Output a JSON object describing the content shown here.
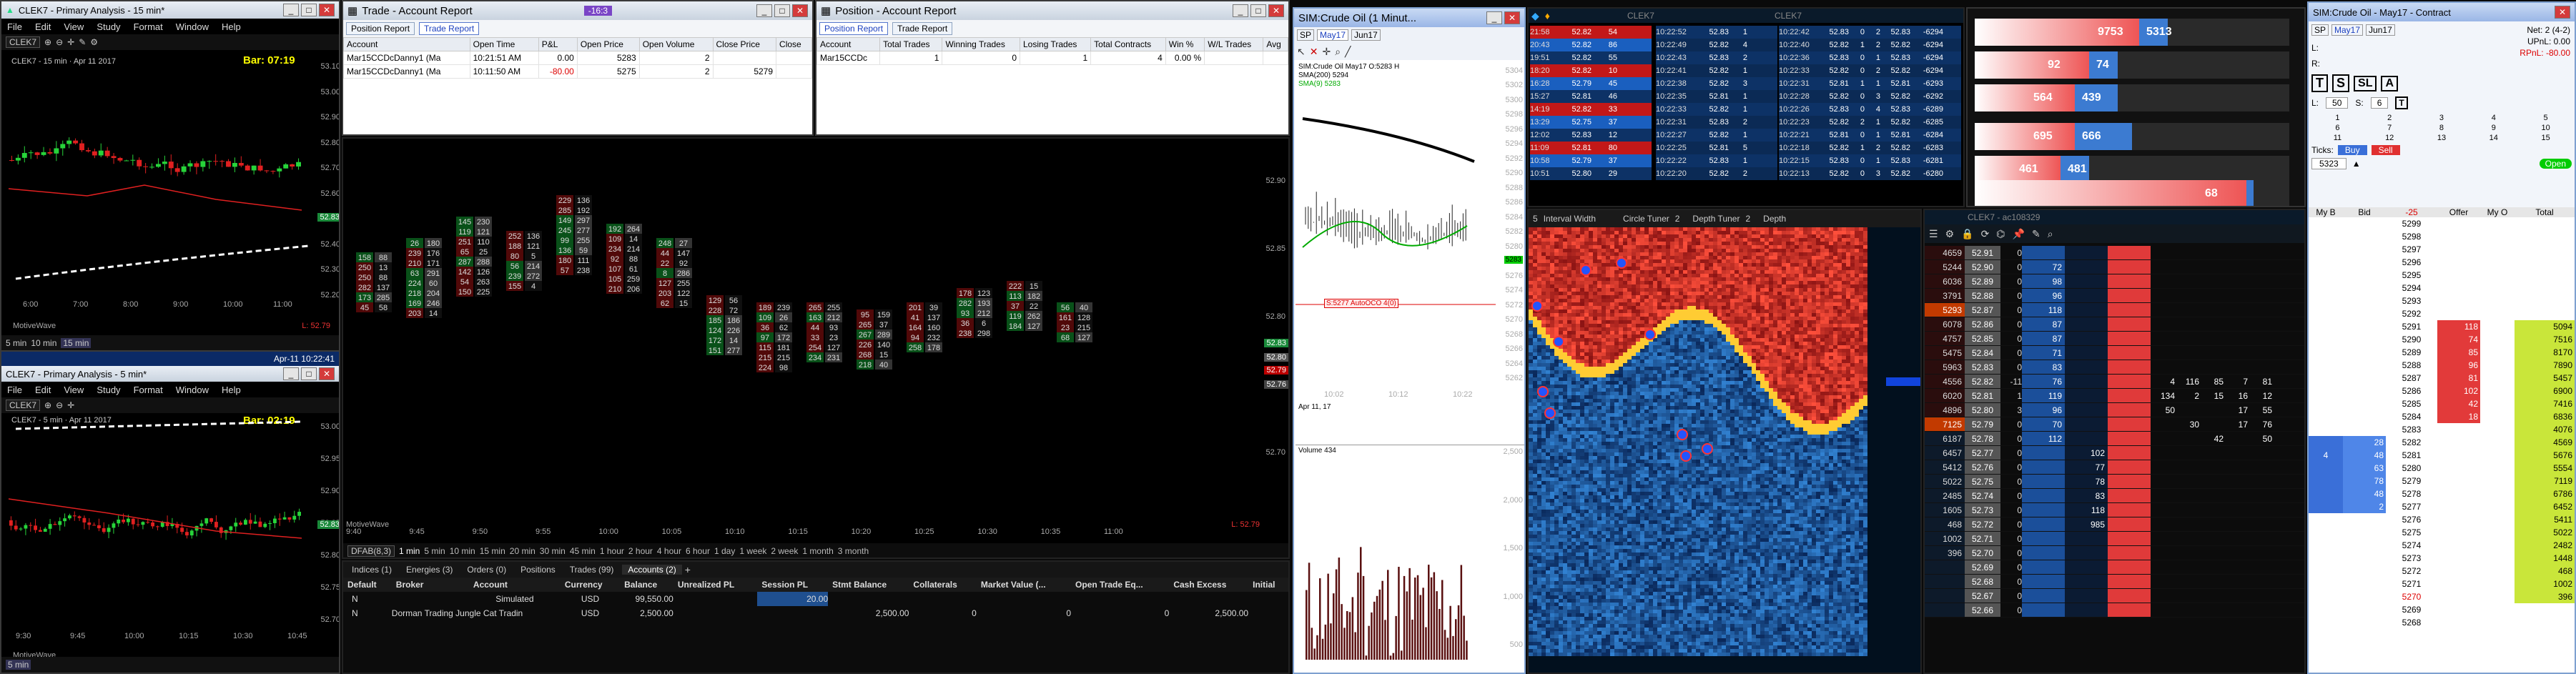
{
  "chart1": {
    "title": "CLEK7 - Primary Analysis - 15 min*",
    "instrument": "CLEK7",
    "chart_label": "CLEK7 - 15 min",
    "date": "Apr 11 2017",
    "bar": "Bar: 07:19",
    "menu": [
      "File",
      "Edit",
      "View",
      "Study",
      "Format",
      "Window",
      "Help"
    ],
    "yticks": [
      "53.10",
      "53.00",
      "52.90",
      "52.80",
      "52.70",
      "52.60",
      "52.50",
      "52.40",
      "52.30",
      "52.20"
    ],
    "last_tag": "52.83",
    "xticks": [
      "6:00",
      "7:00",
      "8:00",
      "9:00",
      "10:00",
      "11:00"
    ],
    "footer": "MotiveWave",
    "ll": "L: 52.79",
    "tfs": [
      "5 min",
      "10 min",
      "15 min"
    ]
  },
  "chart2": {
    "title": "CLEK7 - Primary Analysis - 5 min*",
    "instrument": "CLEK7",
    "chart_label": "CLEK7 - 5 min",
    "date": "Apr 11 2017",
    "bar": "Bar: 02:19",
    "time": "Apr-11 10:22:41",
    "menu": [
      "File",
      "Edit",
      "View",
      "Study",
      "Format",
      "Window",
      "Help"
    ],
    "yticks": [
      "53.00",
      "52.95",
      "52.90",
      "52.85",
      "52.80",
      "52.75",
      "52.70"
    ],
    "last_tag": "52.83",
    "xticks": [
      "9:30",
      "9:45",
      "10:00",
      "10:15",
      "10:30",
      "10:45"
    ],
    "footer": "MotiveWave",
    "ll": "L: 52.79",
    "tf": "5 min"
  },
  "trade_report": {
    "title": "Trade - Account Report",
    "tabs": [
      "Position Report",
      "Trade Report"
    ],
    "headers": [
      "Account",
      "Open Time",
      "P&L",
      "Open Price",
      "Open Volume",
      "Close Price",
      "Close"
    ],
    "rows": [
      [
        "Mar15CCDcDanny1 (Ma",
        "10:21:51 AM",
        "0.00",
        "5283",
        "2",
        ""
      ],
      [
        "Mar15CCDcDanny1 (Ma",
        "10:11:50 AM",
        "-80.00",
        "5275",
        "2",
        "5279"
      ]
    ],
    "badge": "-16:3"
  },
  "position_report": {
    "title": "Position - Account Report",
    "tabs": [
      "Position Report",
      "Trade Report"
    ],
    "headers": [
      "Account",
      "Total Trades",
      "Winning Trades",
      "Losing Trades",
      "Total Contracts",
      "Win %",
      "W/L Trades",
      "Avg"
    ],
    "rows": [
      [
        "Mar15CCDc",
        "1",
        "0",
        "1",
        "4",
        "0.00 %",
        "",
        ""
      ]
    ]
  },
  "footprint": {
    "yticks": [
      "52.90",
      "52.85",
      "52.80",
      "52.75",
      "52.70"
    ],
    "tags": [
      "52.83",
      "52.80",
      "52.79",
      "52.76"
    ],
    "xticks": [
      "9:40",
      "9:45",
      "9:50",
      "9:55",
      "10:00",
      "10:05",
      "10:10",
      "10:15",
      "10:20",
      "10:25",
      "10:30",
      "10:35",
      "11:00"
    ],
    "footer": "MotiveWave",
    "ll": "L: 52.79",
    "label": "DFAB(8,3)",
    "tfs": [
      "1 min",
      "5 min",
      "10 min",
      "15 min",
      "20 min",
      "30 min",
      "45 min",
      "1 hour",
      "2 hour",
      "4 hour",
      "6 hour",
      "1 day",
      "1 week",
      "2 week",
      "1 month",
      "3 month"
    ]
  },
  "accounts": {
    "tabs": [
      "Indices (1)",
      "Energies (3)",
      "Orders (0)",
      "Positions",
      "Trades (99)",
      "Accounts (2)"
    ],
    "headers": [
      "Default",
      "Broker",
      "Account",
      "Currency",
      "Balance",
      "Unrealized PL",
      "Session PL",
      "Stmt Balance",
      "Collaterals",
      "Market Value (...",
      "Open Trade Eq...",
      "Cash Excess",
      "Initial"
    ],
    "rows": [
      [
        "N",
        "",
        "Simulated",
        "USD",
        "99,550.00",
        "",
        "20.00",
        "",
        "",
        "",
        "",
        "",
        ""
      ],
      [
        "N",
        "Dorman Trading Jungle Cat Tradin",
        "",
        "USD",
        "2,500.00",
        "",
        "",
        "2,500.00",
        "0",
        "0",
        "0",
        "2,500.00",
        ""
      ]
    ]
  },
  "ninja": {
    "title": "SIM:Crude Oil (1 Minut...",
    "selector": "SP",
    "contract": "May17",
    "other": "Jun17",
    "info": "SIM:Crude Oil May17 O:5283 H",
    "indicators": [
      "SMA(200) 5294",
      "SMA(9) 5283"
    ],
    "yticks": [
      "5304",
      "5302",
      "5300",
      "5298",
      "5296",
      "5294",
      "5292",
      "5290",
      "5288",
      "5286",
      "5284",
      "5282",
      "5280",
      "5278",
      "5276",
      "5274",
      "5272",
      "5270",
      "5268",
      "5266",
      "5264",
      "5262"
    ],
    "order_label": "S:5277 AutoOCO 4(0)",
    "last": "5283",
    "xticks": [
      "10:02",
      "10:12",
      "10:22"
    ],
    "date": "Apr 11, 17",
    "volume_label": "Volume 434",
    "vticks": [
      "2,500",
      "2,000",
      "1,500",
      "1,000",
      "500"
    ]
  },
  "tape": {
    "panel1": [
      [
        "21:58",
        "52.82",
        "54"
      ],
      [
        "20:43",
        "52.82",
        "86"
      ],
      [
        "19:51",
        "52.82",
        "55"
      ],
      [
        "18:20",
        "52.82",
        "10"
      ],
      [
        "16:28",
        "52.79",
        "45"
      ],
      [
        "15:27",
        "52.81",
        "46"
      ],
      [
        "14:19",
        "52.82",
        "33"
      ],
      [
        "13:29",
        "52.75",
        "37"
      ],
      [
        "12:02",
        "52.83",
        "12"
      ],
      [
        "11:09",
        "52.81",
        "80"
      ],
      [
        "10:58",
        "52.79",
        "37"
      ],
      [
        "10:51",
        "52.80",
        "29"
      ]
    ],
    "title": "CLEK7",
    "title2": "CLEK7",
    "panel2": [
      [
        "10:22:52",
        "52.83",
        "1"
      ],
      [
        "10:22:49",
        "52.82",
        "4"
      ],
      [
        "10:22:43",
        "52.83",
        "2"
      ],
      [
        "10:22:41",
        "52.82",
        "1"
      ],
      [
        "10:22:38",
        "52.82",
        "3"
      ],
      [
        "10:22:35",
        "52.81",
        "1"
      ],
      [
        "10:22:33",
        "52.82",
        "1"
      ],
      [
        "10:22:31",
        "52.83",
        "2"
      ],
      [
        "10:22:27",
        "52.82",
        "1"
      ],
      [
        "10:22:25",
        "52.81",
        "5"
      ],
      [
        "10:22:22",
        "52.83",
        "1"
      ],
      [
        "10:22:20",
        "52.82",
        "2"
      ]
    ],
    "panel3": [
      [
        "10:22:42",
        "52.83",
        "0",
        "2",
        "52.83",
        "-6294"
      ],
      [
        "10:22:40",
        "52.82",
        "1",
        "2",
        "52.82",
        "-6294"
      ],
      [
        "10:22:36",
        "52.83",
        "0",
        "1",
        "52.83",
        "-6294"
      ],
      [
        "10:22:33",
        "52.82",
        "0",
        "2",
        "52.82",
        "-6294"
      ],
      [
        "10:22:31",
        "52.81",
        "1",
        "1",
        "52.81",
        "-6293"
      ],
      [
        "10:22:28",
        "52.82",
        "0",
        "3",
        "52.82",
        "-6292"
      ],
      [
        "10:22:26",
        "52.83",
        "0",
        "4",
        "52.83",
        "-6289"
      ],
      [
        "10:22:23",
        "52.82",
        "2",
        "1",
        "52.82",
        "-6285"
      ],
      [
        "10:22:21",
        "52.81",
        "0",
        "1",
        "52.81",
        "-6284"
      ],
      [
        "10:22:18",
        "52.82",
        "1",
        "2",
        "52.82",
        "-6283"
      ],
      [
        "10:22:15",
        "52.83",
        "0",
        "1",
        "52.83",
        "-6281"
      ],
      [
        "10:22:13",
        "52.82",
        "0",
        "3",
        "52.82",
        "-6280"
      ]
    ]
  },
  "dom_bars": {
    "rows": [
      [
        "9753",
        "5313"
      ],
      [
        "92",
        "74"
      ],
      [
        "564",
        "439"
      ]
    ],
    "rows2": [
      [
        "695",
        "666"
      ],
      [
        "461",
        "481"
      ],
      [
        "68",
        ""
      ]
    ]
  },
  "heatmap": {
    "interval": "Interval Width",
    "circle": "Circle Tuner",
    "depth": "Depth Tuner",
    "depth2": "Depth",
    "iw": "5",
    "ct": "2",
    "dt": "2"
  },
  "ladder1": {
    "title": "CLEK7 - ac108329",
    "rows": [
      [
        "4659",
        "52.91",
        "0",
        "",
        ""
      ],
      [
        "5244",
        "52.90",
        "0",
        "72",
        ""
      ],
      [
        "6036",
        "52.89",
        "0",
        "98",
        ""
      ],
      [
        "3791",
        "52.88",
        "0",
        "96",
        ""
      ],
      [
        "5293",
        "52.87",
        "0",
        "118",
        ""
      ],
      [
        "6078",
        "52.86",
        "0",
        "87",
        ""
      ],
      [
        "4757",
        "52.85",
        "0",
        "87",
        ""
      ],
      [
        "5475",
        "52.84",
        "0",
        "71",
        ""
      ],
      [
        "5963",
        "52.83",
        "0",
        "83",
        ""
      ],
      [
        "4556",
        "52.82",
        "-11",
        "76",
        ""
      ],
      [
        "6020",
        "52.81",
        "1",
        "119",
        ""
      ],
      [
        "4896",
        "52.80",
        "3",
        "96",
        ""
      ],
      [
        "7125",
        "52.79",
        "0",
        "70",
        ""
      ],
      [
        "6187",
        "52.78",
        "0",
        "112",
        ""
      ],
      [
        "6457",
        "52.77",
        "0",
        "",
        "102"
      ],
      [
        "5412",
        "52.76",
        "0",
        "",
        "77"
      ],
      [
        "5022",
        "52.75",
        "0",
        "",
        "78"
      ],
      [
        "2485",
        "52.74",
        "0",
        "",
        "83"
      ],
      [
        "1605",
        "52.73",
        "0",
        "",
        "118"
      ],
      [
        "468",
        "52.72",
        "0",
        "",
        "985"
      ],
      [
        "1002",
        "52.71",
        "0",
        "",
        ""
      ],
      [
        "396",
        "52.70",
        "0",
        "",
        ""
      ],
      [
        "",
        "52.69",
        "0",
        "",
        ""
      ],
      [
        "",
        "52.68",
        "0",
        "",
        ""
      ],
      [
        "",
        "52.67",
        "0",
        "",
        ""
      ],
      [
        "",
        "52.66",
        "0",
        "",
        ""
      ]
    ]
  },
  "ladder2": {
    "rows": [
      [
        "4",
        "116",
        "85",
        "7",
        "81"
      ],
      [
        "134",
        "2",
        "15",
        "16",
        "12"
      ],
      [
        "50",
        "",
        "",
        "17",
        "55"
      ],
      [
        "",
        "30",
        "",
        "17",
        "76"
      ],
      [
        "",
        "",
        "42",
        "",
        "50"
      ]
    ]
  },
  "sim_dom": {
    "title": "SIM:Crude Oil - May17 - Contract",
    "selector": "SP",
    "contract": "May17",
    "other": "Jun17",
    "net": "Net: 2 (4-2)",
    "upl": "UPnL: 0.00",
    "rpl": "RPnL: -80.00",
    "L": "L:",
    "R": "R:",
    "lval": "50",
    "sval": "6",
    "ticks": "Ticks:",
    "buy": "Buy",
    "sell": "Sell",
    "open": "Open",
    "price": "5323",
    "headers": [
      "My B",
      "Bid",
      "-25",
      "Offer",
      "My O",
      "Total"
    ],
    "prices": [
      "5299",
      "5298",
      "5297",
      "5296",
      "5295",
      "5294",
      "5293",
      "5292",
      "5291",
      "5290",
      "5289",
      "5288",
      "5287",
      "5286",
      "5285",
      "5284",
      "5283",
      "5282",
      "5281",
      "5280",
      "5279",
      "5278",
      "5277",
      "5276",
      "5275",
      "5274",
      "5273",
      "5272",
      "5271",
      "5270",
      "5269",
      "5268"
    ],
    "offers": [
      "",
      "",
      "",
      "",
      "",
      "",
      "",
      "",
      "118",
      "74",
      "85",
      "96",
      "81",
      "102",
      "42",
      "18",
      "",
      "",
      "",
      "",
      "",
      "",
      "",
      "",
      "",
      "",
      "",
      "",
      "",
      "",
      "",
      ""
    ],
    "bids": [
      "",
      "",
      "",
      "",
      "",
      "",
      "",
      "",
      "",
      "",
      "",
      "",
      "",
      "",
      "",
      "",
      "",
      "28",
      "48",
      "63",
      "78",
      "48",
      "2",
      "",
      "",
      "",
      "",
      "",
      "",
      "",
      "",
      ""
    ],
    "totals": [
      "",
      "",
      "",
      "",
      "",
      "",
      "",
      "",
      "5094",
      "7516",
      "8170",
      "7890",
      "5457",
      "6900",
      "7416",
      "6836",
      "4076",
      "4569",
      "5676",
      "5554",
      "7119",
      "6786",
      "6452",
      "5411",
      "5022",
      "2482",
      "1448",
      "468",
      "1002",
      "396",
      "",
      ""
    ],
    "my_b": [
      "",
      "",
      "",
      "",
      "",
      "",
      "",
      "",
      "",
      "",
      "",
      "",
      "",
      "",
      "",
      "",
      "",
      "",
      "4",
      "",
      "",
      "",
      "",
      "",
      "",
      "",
      "",
      "",
      "",
      "",
      "",
      ""
    ],
    "ladder_cols": [
      "1",
      "2",
      "3",
      "4",
      "5",
      "6",
      "7",
      "8",
      "9",
      "10",
      "11",
      "12",
      "13",
      "14",
      "15"
    ]
  },
  "dom_top_tags": {
    "a": "8:0",
    "b": "2"
  }
}
